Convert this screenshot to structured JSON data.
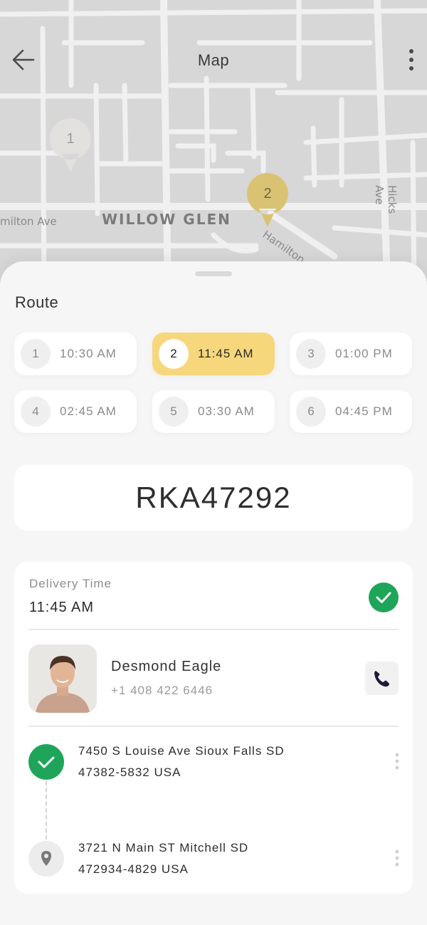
{
  "header": {
    "title": "Map"
  },
  "map": {
    "labels": {
      "district": "WILLOW GLEN",
      "street_left": "milton Ave",
      "street_right": "Hamilton Av",
      "street_vertical": "Hicks Ave"
    },
    "pins": [
      {
        "number": "1",
        "color": "#e3e1de"
      },
      {
        "number": "2",
        "color": "#d9c373"
      }
    ]
  },
  "route": {
    "title": "Route",
    "slots": [
      {
        "number": "1",
        "time": "10:30 AM",
        "active": false
      },
      {
        "number": "2",
        "time": "11:45 AM",
        "active": true
      },
      {
        "number": "3",
        "time": "01:00 PM",
        "active": false
      },
      {
        "number": "4",
        "time": "02:45 AM",
        "active": false
      },
      {
        "number": "5",
        "time": "03:30 AM",
        "active": false
      },
      {
        "number": "6",
        "time": "04:45 PM",
        "active": false
      }
    ],
    "active_color": "#f6d77b"
  },
  "order": {
    "code": "RKA47292"
  },
  "delivery": {
    "label": "Delivery Time",
    "time": "11:45 AM",
    "status_icon": "check-circle-icon",
    "status_color": "#1fa55a"
  },
  "contact": {
    "name": "Desmond Eagle",
    "phone": "+1 408 422 6446",
    "call_icon": "phone-icon"
  },
  "stops": [
    {
      "line1": "7450 S Louise Ave Sioux Falls SD",
      "line2": "47382-5832 USA",
      "icon": "check-icon",
      "done": true
    },
    {
      "line1": "3721 N Main ST Mitchell SD",
      "line2": "472934-4829 USA",
      "icon": "location-pin-icon",
      "done": false
    }
  ]
}
